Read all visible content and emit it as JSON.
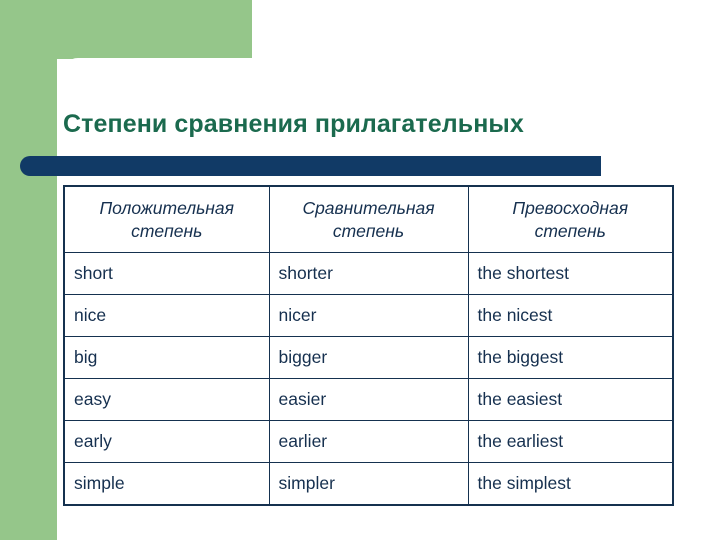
{
  "slide": {
    "title": "Степени сравнения прилагательных",
    "accent_color": "#113a66",
    "title_color": "#1b6a4e",
    "decor_color": "#95c68a",
    "text_color": "#16304f",
    "background_color": "#ffffff"
  },
  "table": {
    "headers": [
      {
        "line1": "Положительная",
        "line2": "степень"
      },
      {
        "line1": "Сравнительная",
        "line2": "степень"
      },
      {
        "line1": "Превосходная",
        "line2": "степень"
      }
    ],
    "rows": [
      {
        "positive": "short",
        "comparative": "shorter",
        "superlative": "the shortest"
      },
      {
        "positive": "nice",
        "comparative": "nicer",
        "superlative": "the nicest"
      },
      {
        "positive": "big",
        "comparative": "bigger",
        "superlative": "the biggest"
      },
      {
        "positive": "easy",
        "comparative": "easier",
        "superlative": "the easiest"
      },
      {
        "positive": "early",
        "comparative": "earlier",
        "superlative": "the earliest"
      },
      {
        "positive": "simple",
        "comparative": "simpler",
        "superlative": "the simplest"
      }
    ]
  }
}
